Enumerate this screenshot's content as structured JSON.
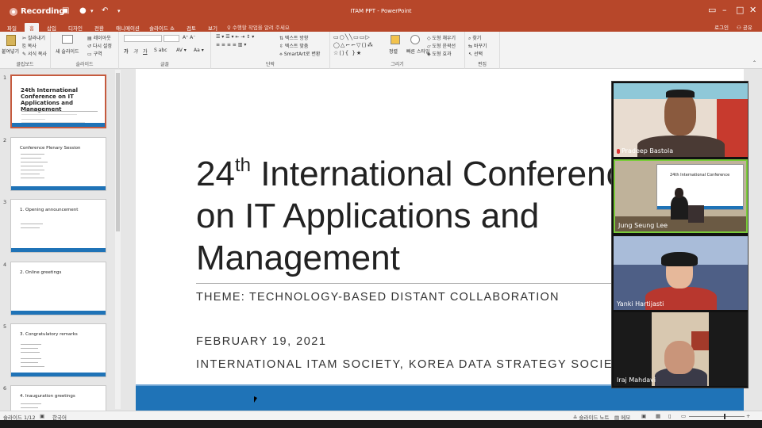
{
  "app": {
    "recording_label": "Recording",
    "document_title": "ITAM PPT - PowerPoint",
    "accent_color": "#b7472a",
    "slide_band_color": "#1f73b7"
  },
  "tabs": {
    "file": "파일",
    "home": "홈",
    "insert": "삽입",
    "design": "디자인",
    "transitions": "전환",
    "animations": "애니메이션",
    "slideshow": "슬라이드 쇼",
    "review": "검토",
    "view": "보기",
    "tell_me": "수행할 작업을 알려 주세요",
    "login": "로그인",
    "share": "공유"
  },
  "ribbon": {
    "paste": "붙여넣기",
    "cut": "잘라내기",
    "copy": "복사",
    "format_painter": "서식 복사",
    "new_slide": "새 슬라이드",
    "layout": "레이아웃",
    "reset": "다시 설정",
    "section": "구역",
    "text_direction": "텍스트 방향",
    "align_text": "텍스트 맞춤",
    "smartart": "SmartArt로 변환",
    "arrange": "정렬",
    "quick_styles": "빠른 스타일",
    "shape_fill": "도형 채우기",
    "shape_outline": "도형 윤곽선",
    "shape_effects": "도형 효과",
    "find": "찾기",
    "replace": "바꾸기",
    "select": "선택",
    "groups": {
      "clipboard": "클립보드",
      "slides": "슬라이드",
      "font": "글꼴",
      "paragraph": "단락",
      "drawing": "그리기",
      "editing": "편집"
    }
  },
  "thumbnails": [
    {
      "num": "1",
      "title": "24th International Conference on IT Applications and Management"
    },
    {
      "num": "2",
      "title": "Conference Plenary Session"
    },
    {
      "num": "3",
      "title": "1. Opening announcement"
    },
    {
      "num": "4",
      "title": "2. Online greetings"
    },
    {
      "num": "5",
      "title": "3. Congratulatory remarks"
    },
    {
      "num": "6",
      "title": "4. Inauguration greetings"
    }
  ],
  "slide": {
    "title_prefix": "24",
    "title_sup": "th",
    "title_line1_rest": " International Conference",
    "title_line2": "on IT Applications and",
    "title_line3": "Management",
    "theme": "THEME: TECHNOLOGY-BASED DISTANT COLLABORATION",
    "date": "FEBRUARY 19, 2021",
    "organizers": "INTERNATIONAL ITAM SOCIETY, KOREA DATA STRATEGY SOCIETY"
  },
  "participants": [
    {
      "name": "Pradeep Bastola",
      "muted": true
    },
    {
      "name": "Jung Seung Lee",
      "muted": false,
      "speaking": true
    },
    {
      "name": "Yanki Hartijasti",
      "muted": false
    },
    {
      "name": "Iraj Mahdavi",
      "muted": false
    }
  ],
  "statusbar": {
    "slide_count": "슬라이드 1/12",
    "language": "한국어",
    "notes": "슬라이드 노트",
    "comments": "메모"
  }
}
